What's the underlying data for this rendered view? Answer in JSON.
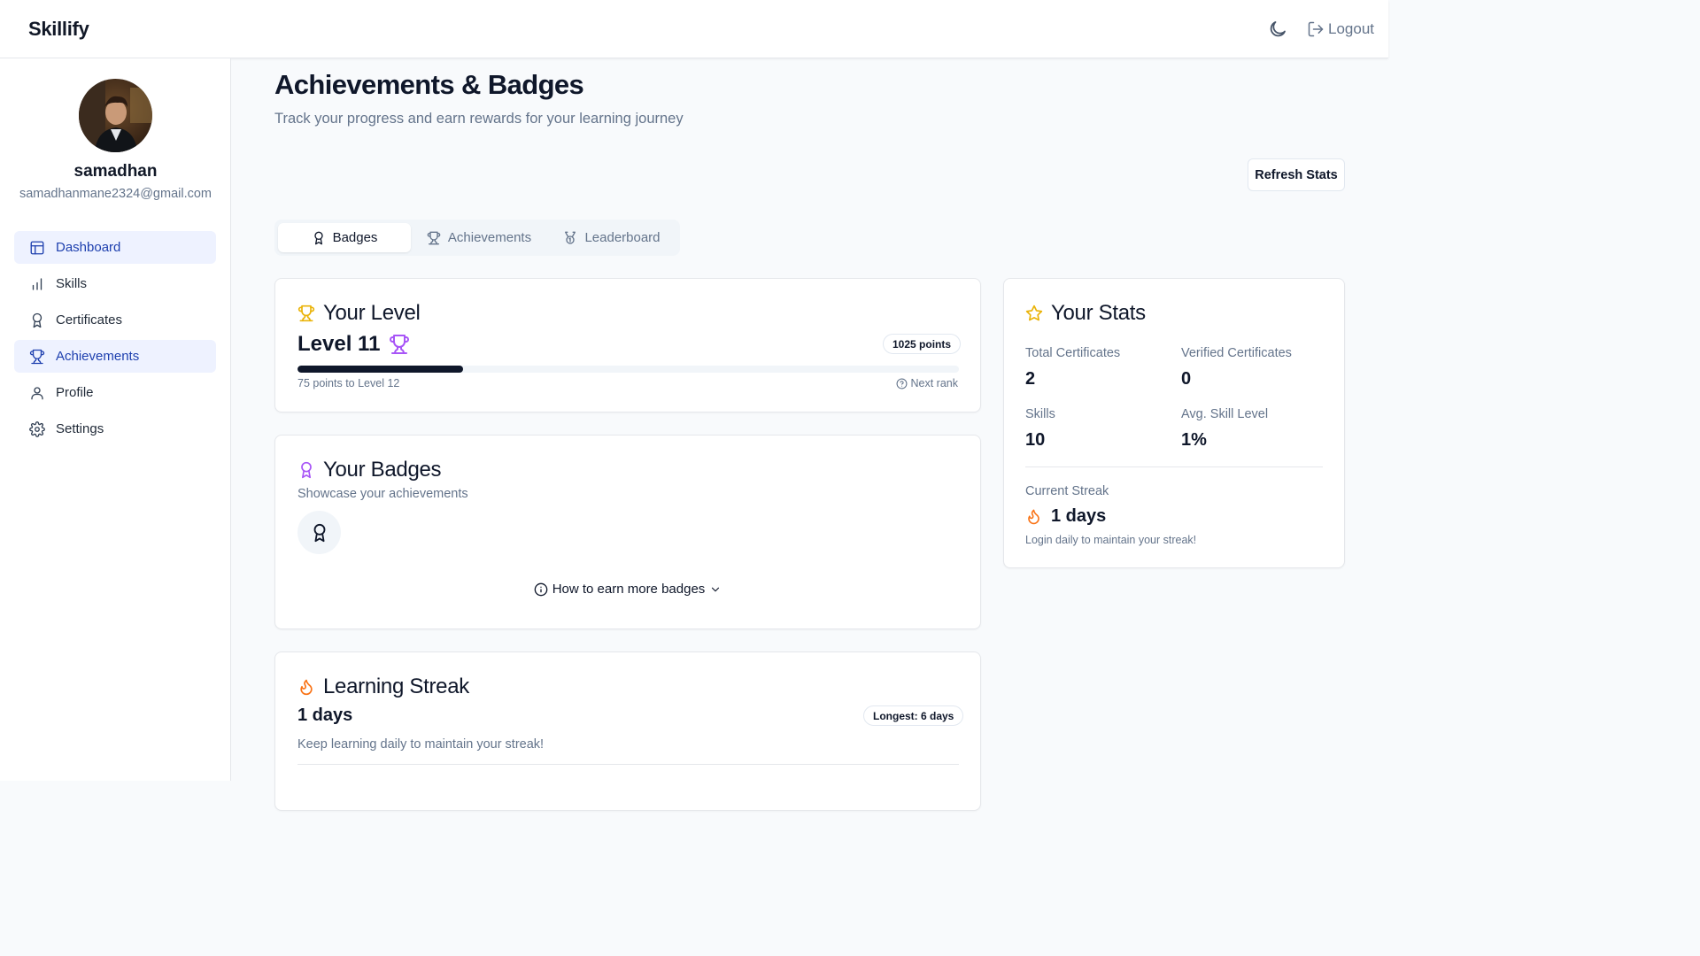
{
  "app": {
    "brand": "Skillify",
    "logout_label": "Logout"
  },
  "user": {
    "name": "samadhan",
    "email": "samadhanmane2324@gmail.com"
  },
  "sidebar": {
    "items": [
      {
        "label": "Dashboard",
        "icon": "dashboard-icon",
        "active": true
      },
      {
        "label": "Skills",
        "icon": "bar-chart-icon",
        "active": false
      },
      {
        "label": "Certificates",
        "icon": "award-icon",
        "active": false
      },
      {
        "label": "Achievements",
        "icon": "trophy-icon",
        "active": true
      },
      {
        "label": "Profile",
        "icon": "user-icon",
        "active": false
      },
      {
        "label": "Settings",
        "icon": "gear-icon",
        "active": false
      }
    ]
  },
  "page": {
    "title": "Achievements & Badges",
    "subtitle": "Track your progress and earn rewards for your learning journey",
    "refresh_label": "Refresh Stats"
  },
  "tabs": [
    {
      "label": "Badges",
      "active": true
    },
    {
      "label": "Achievements",
      "active": false
    },
    {
      "label": "Leaderboard",
      "active": false
    }
  ],
  "level": {
    "title": "Your Level",
    "level_text": "Level 11",
    "points_badge": "1025 points",
    "progress_fraction": 0.25,
    "to_next": "75 points to Level 12",
    "next_rank_label": "Next rank"
  },
  "badges": {
    "title": "Your Badges",
    "subtitle": "Showcase your achievements",
    "how_to_label": "How to earn more badges"
  },
  "streak": {
    "title": "Learning Streak",
    "days_text": "1 days",
    "longest_badge": "Longest: 6 days",
    "hint": "Keep learning daily to maintain your streak!"
  },
  "stats": {
    "title": "Your Stats",
    "total_certificates_label": "Total Certificates",
    "total_certificates_value": "2",
    "verified_certificates_label": "Verified Certificates",
    "verified_certificates_value": "0",
    "skills_label": "Skills",
    "skills_value": "10",
    "avg_skill_label": "Avg. Skill Level",
    "avg_skill_value": "1%",
    "current_streak_label": "Current Streak",
    "current_streak_value": "1 days",
    "streak_hint": "Login daily to maintain your streak!"
  },
  "colors": {
    "accent_blue": "#1e40af",
    "active_nav_bg": "#eef2ff",
    "trophy_yellow": "#eab308",
    "badge_purple": "#a855f7",
    "streak_orange": "#f97316",
    "progress_dark": "#0f172a"
  }
}
